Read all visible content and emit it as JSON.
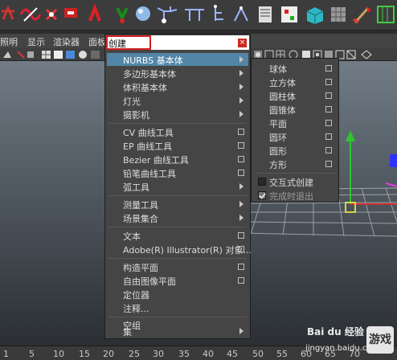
{
  "panel_menubar": [
    "照明",
    "显示",
    "渲染器",
    "面板"
  ],
  "create_menu": {
    "title": "创建",
    "close": "×",
    "items": [
      {
        "label": "NURBS 基本体",
        "submenu": true,
        "highlight": true
      },
      {
        "label": "多边形基本体",
        "submenu": true
      },
      {
        "label": "体积基本体",
        "submenu": true
      },
      {
        "label": "灯光",
        "submenu": true
      },
      {
        "label": "摄影机",
        "submenu": true
      },
      {
        "label": "CV 曲线工具",
        "option": true
      },
      {
        "label": "EP 曲线工具",
        "option": true
      },
      {
        "label": "Bezier 曲线工具",
        "option": true
      },
      {
        "label": "铅笔曲线工具",
        "option": true
      },
      {
        "label": "弧工具",
        "submenu": true
      },
      {
        "label": "测量工具",
        "submenu": true
      },
      {
        "label": "场景集合",
        "submenu": true
      },
      {
        "label": "文本",
        "option": true
      },
      {
        "label": "Adobe(R) Illustrator(R) 对象...",
        "option": true
      },
      {
        "label": "构造平面",
        "option": true
      },
      {
        "label": "自由图像平面",
        "option": true
      },
      {
        "label": "定位器"
      },
      {
        "label": "注释..."
      },
      {
        "label": "空组"
      },
      {
        "label": "集",
        "submenu": true
      }
    ]
  },
  "nurbs_submenu": {
    "items": [
      "球体",
      "立方体",
      "圆柱体",
      "圆锥体",
      "平面",
      "圆环",
      "圆形",
      "方形"
    ],
    "interactive_create": "交互式创建",
    "exit_on_completion": "完成时退出"
  },
  "timeline": [
    "1",
    "5",
    "10",
    "15",
    "20",
    "25",
    "30",
    "35",
    "40",
    "45",
    "50",
    "55",
    "60",
    "65",
    "70"
  ],
  "watermark": {
    "brand": "Bai du 经验",
    "url": "jingyan.baidu.com",
    "badge": "游戏"
  },
  "colors": {
    "menu_bg": "#454545",
    "highlight": "#5285a6",
    "title_border": "#d42020",
    "close": "#cc2a1f"
  }
}
